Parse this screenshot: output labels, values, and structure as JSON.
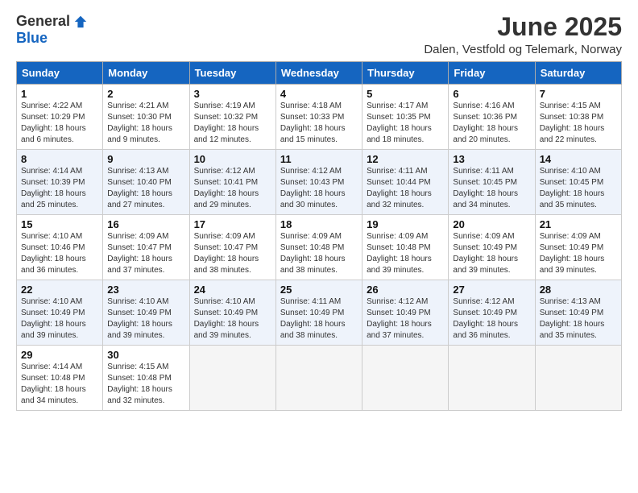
{
  "logo": {
    "general": "General",
    "blue": "Blue"
  },
  "title": "June 2025",
  "location": "Dalen, Vestfold og Telemark, Norway",
  "weekdays": [
    "Sunday",
    "Monday",
    "Tuesday",
    "Wednesday",
    "Thursday",
    "Friday",
    "Saturday"
  ],
  "weeks": [
    [
      {
        "day": "1",
        "sunrise": "4:22 AM",
        "sunset": "10:29 PM",
        "daylight": "18 hours and 6 minutes."
      },
      {
        "day": "2",
        "sunrise": "4:21 AM",
        "sunset": "10:30 PM",
        "daylight": "18 hours and 9 minutes."
      },
      {
        "day": "3",
        "sunrise": "4:19 AM",
        "sunset": "10:32 PM",
        "daylight": "18 hours and 12 minutes."
      },
      {
        "day": "4",
        "sunrise": "4:18 AM",
        "sunset": "10:33 PM",
        "daylight": "18 hours and 15 minutes."
      },
      {
        "day": "5",
        "sunrise": "4:17 AM",
        "sunset": "10:35 PM",
        "daylight": "18 hours and 18 minutes."
      },
      {
        "day": "6",
        "sunrise": "4:16 AM",
        "sunset": "10:36 PM",
        "daylight": "18 hours and 20 minutes."
      },
      {
        "day": "7",
        "sunrise": "4:15 AM",
        "sunset": "10:38 PM",
        "daylight": "18 hours and 22 minutes."
      }
    ],
    [
      {
        "day": "8",
        "sunrise": "4:14 AM",
        "sunset": "10:39 PM",
        "daylight": "18 hours and 25 minutes."
      },
      {
        "day": "9",
        "sunrise": "4:13 AM",
        "sunset": "10:40 PM",
        "daylight": "18 hours and 27 minutes."
      },
      {
        "day": "10",
        "sunrise": "4:12 AM",
        "sunset": "10:41 PM",
        "daylight": "18 hours and 29 minutes."
      },
      {
        "day": "11",
        "sunrise": "4:12 AM",
        "sunset": "10:43 PM",
        "daylight": "18 hours and 30 minutes."
      },
      {
        "day": "12",
        "sunrise": "4:11 AM",
        "sunset": "10:44 PM",
        "daylight": "18 hours and 32 minutes."
      },
      {
        "day": "13",
        "sunrise": "4:11 AM",
        "sunset": "10:45 PM",
        "daylight": "18 hours and 34 minutes."
      },
      {
        "day": "14",
        "sunrise": "4:10 AM",
        "sunset": "10:45 PM",
        "daylight": "18 hours and 35 minutes."
      }
    ],
    [
      {
        "day": "15",
        "sunrise": "4:10 AM",
        "sunset": "10:46 PM",
        "daylight": "18 hours and 36 minutes."
      },
      {
        "day": "16",
        "sunrise": "4:09 AM",
        "sunset": "10:47 PM",
        "daylight": "18 hours and 37 minutes."
      },
      {
        "day": "17",
        "sunrise": "4:09 AM",
        "sunset": "10:47 PM",
        "daylight": "18 hours and 38 minutes."
      },
      {
        "day": "18",
        "sunrise": "4:09 AM",
        "sunset": "10:48 PM",
        "daylight": "18 hours and 38 minutes."
      },
      {
        "day": "19",
        "sunrise": "4:09 AM",
        "sunset": "10:48 PM",
        "daylight": "18 hours and 39 minutes."
      },
      {
        "day": "20",
        "sunrise": "4:09 AM",
        "sunset": "10:49 PM",
        "daylight": "18 hours and 39 minutes."
      },
      {
        "day": "21",
        "sunrise": "4:09 AM",
        "sunset": "10:49 PM",
        "daylight": "18 hours and 39 minutes."
      }
    ],
    [
      {
        "day": "22",
        "sunrise": "4:10 AM",
        "sunset": "10:49 PM",
        "daylight": "18 hours and 39 minutes."
      },
      {
        "day": "23",
        "sunrise": "4:10 AM",
        "sunset": "10:49 PM",
        "daylight": "18 hours and 39 minutes."
      },
      {
        "day": "24",
        "sunrise": "4:10 AM",
        "sunset": "10:49 PM",
        "daylight": "18 hours and 39 minutes."
      },
      {
        "day": "25",
        "sunrise": "4:11 AM",
        "sunset": "10:49 PM",
        "daylight": "18 hours and 38 minutes."
      },
      {
        "day": "26",
        "sunrise": "4:12 AM",
        "sunset": "10:49 PM",
        "daylight": "18 hours and 37 minutes."
      },
      {
        "day": "27",
        "sunrise": "4:12 AM",
        "sunset": "10:49 PM",
        "daylight": "18 hours and 36 minutes."
      },
      {
        "day": "28",
        "sunrise": "4:13 AM",
        "sunset": "10:49 PM",
        "daylight": "18 hours and 35 minutes."
      }
    ],
    [
      {
        "day": "29",
        "sunrise": "4:14 AM",
        "sunset": "10:48 PM",
        "daylight": "18 hours and 34 minutes."
      },
      {
        "day": "30",
        "sunrise": "4:15 AM",
        "sunset": "10:48 PM",
        "daylight": "18 hours and 32 minutes."
      },
      null,
      null,
      null,
      null,
      null
    ]
  ],
  "labels": {
    "sunrise": "Sunrise:",
    "sunset": "Sunset:",
    "daylight": "Daylight:"
  }
}
